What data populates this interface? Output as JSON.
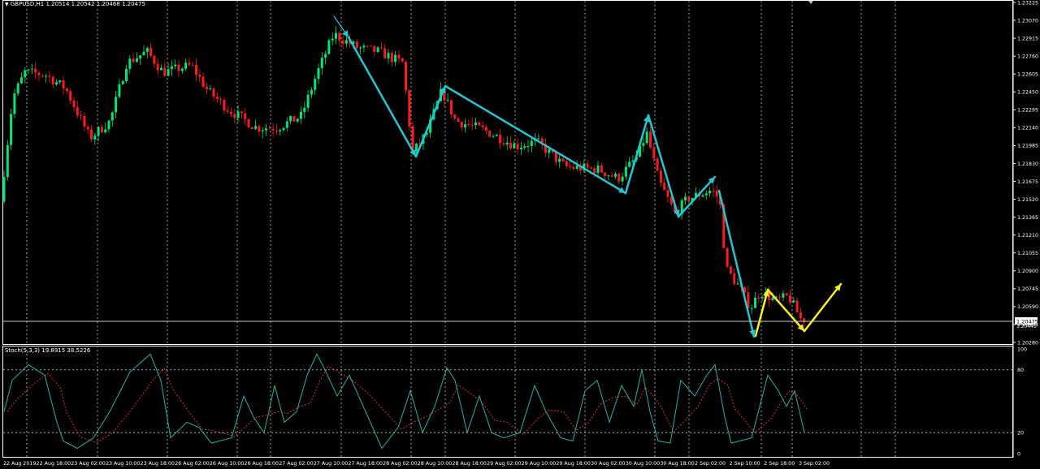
{
  "header": {
    "symbol_menu_icon": "triangle-down-icon",
    "symbol": "GBPUSD,H1",
    "quote": "1.20514 1.20542 1.20468 1.20475"
  },
  "stoch": {
    "label": "Stoch(5,3,3) 19.8915 38.5226",
    "levels": [
      "100",
      "80",
      "20",
      "0"
    ]
  },
  "price_axis": {
    "ticks": [
      "1.23225",
      "1.23070",
      "1.22915",
      "1.22760",
      "1.22605",
      "1.22450",
      "1.22295",
      "1.22140",
      "1.21985",
      "1.21830",
      "1.21675",
      "1.21520",
      "1.21365",
      "1.21210",
      "1.21055",
      "1.20900",
      "1.20745",
      "1.20590",
      "1.20435",
      "1.20280"
    ],
    "current_price": "1.20475",
    "current_price_top": "1.20445"
  },
  "time_axis": {
    "labels": [
      "22 Aug 2019",
      "22 Aug 18:00",
      "23 Aug 02:00",
      "23 Aug 10:00",
      "23 Aug 18:00",
      "26 Aug 02:00",
      "26 Aug 10:00",
      "26 Aug 18:00",
      "27 Aug 02:00",
      "27 Aug 10:00",
      "27 Aug 18:00",
      "28 Aug 02:00",
      "28 Aug 10:00",
      "28 Aug 18:00",
      "29 Aug 02:00",
      "29 Aug 10:00",
      "29 Aug 18:00",
      "30 Aug 02:00",
      "30 Aug 10:00",
      "30 Aug 18:00",
      "2 Sep 02:00",
      "2 Sep 10:00",
      "2 Sep 18:00",
      "3 Sep 02:00"
    ]
  },
  "colors": {
    "background": "#000000",
    "bull_candle": "#00e676",
    "bear_candle": "#ff1a1a",
    "zigzag": "#22c7d6",
    "projection": "#ffee22",
    "stoch_main": "#1fb5a8",
    "stoch_signal": "#ff3030",
    "grid": "#c8c8c8"
  }
}
